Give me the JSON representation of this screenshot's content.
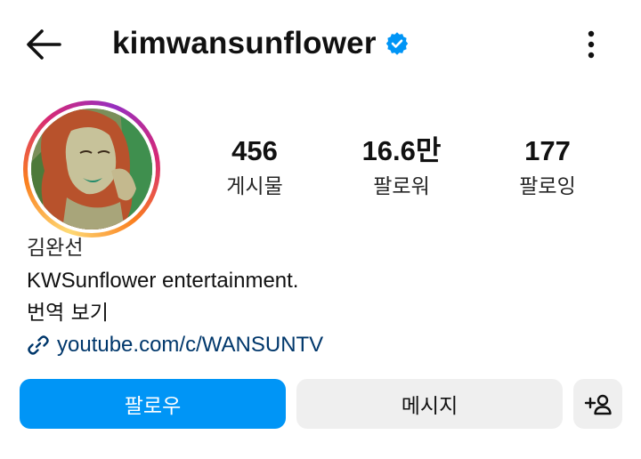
{
  "header": {
    "username": "kimwansunflower",
    "verified": true,
    "back_icon": "arrow-left-icon",
    "more_icon": "more-vertical-icon"
  },
  "profile": {
    "avatar_icon": "profile-photo"
  },
  "stats": [
    {
      "value": "456",
      "label": "게시물"
    },
    {
      "value": "16.6만",
      "label": "팔로워"
    },
    {
      "value": "177",
      "label": "팔로잉"
    }
  ],
  "bio": {
    "name": "김완선",
    "description": "KWSunflower entertainment.",
    "translate": "번역 보기",
    "link": "youtube.com/c/WANSUNTV"
  },
  "actions": {
    "follow": "팔로우",
    "message": "메시지",
    "suggest_icon": "add-person-icon"
  },
  "colors": {
    "primary": "#0095f6",
    "secondary_bg": "#efefef",
    "link": "#00376b",
    "verified": "#0095f6"
  }
}
